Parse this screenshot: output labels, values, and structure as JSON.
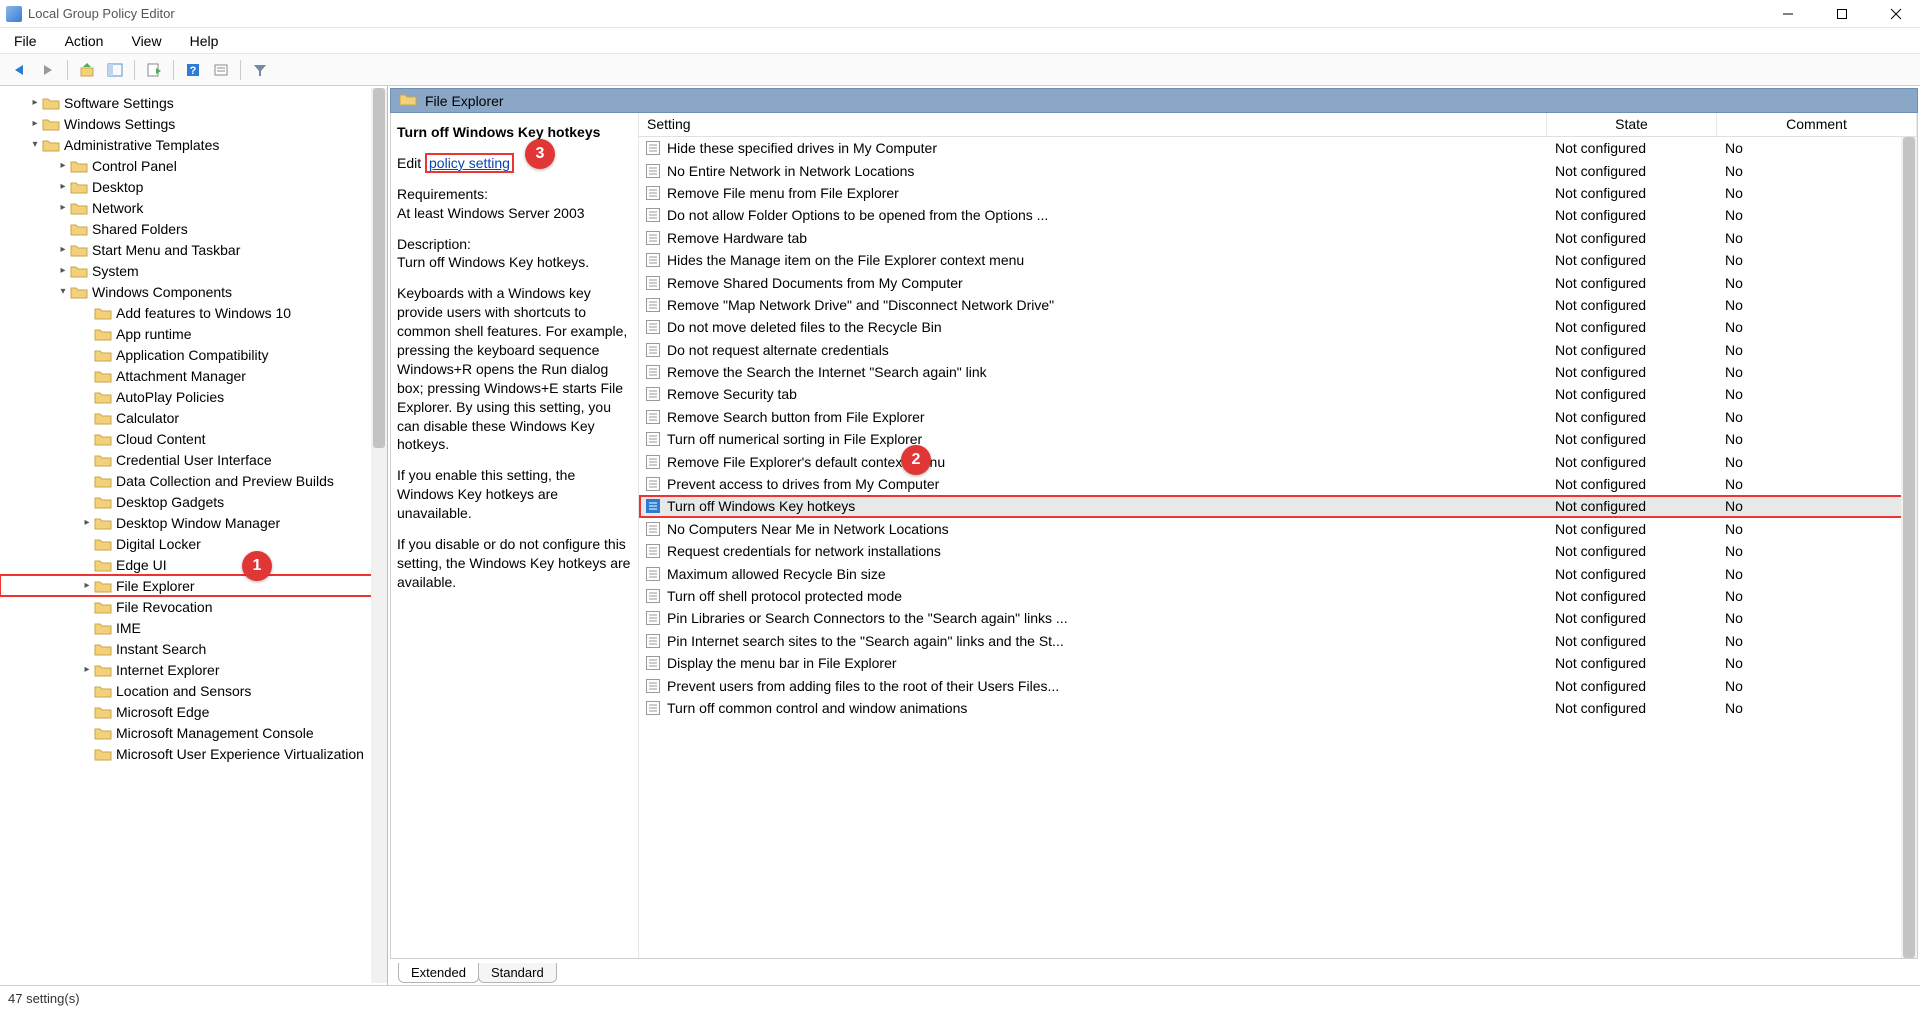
{
  "window": {
    "title": "Local Group Policy Editor"
  },
  "menubar": [
    "File",
    "Action",
    "View",
    "Help"
  ],
  "tree": {
    "root": [
      {
        "label": "Software Settings",
        "indent": 0,
        "chev": ">"
      },
      {
        "label": "Windows Settings",
        "indent": 0,
        "chev": ">"
      },
      {
        "label": "Administrative Templates",
        "indent": 0,
        "chev": "v"
      },
      {
        "label": "Control Panel",
        "indent": 1,
        "chev": ">"
      },
      {
        "label": "Desktop",
        "indent": 1,
        "chev": ">"
      },
      {
        "label": "Network",
        "indent": 1,
        "chev": ">"
      },
      {
        "label": "Shared Folders",
        "indent": 1,
        "chev": ""
      },
      {
        "label": "Start Menu and Taskbar",
        "indent": 1,
        "chev": ">"
      },
      {
        "label": "System",
        "indent": 1,
        "chev": ">"
      },
      {
        "label": "Windows Components",
        "indent": 1,
        "chev": "v"
      },
      {
        "label": "Add features to Windows 10",
        "indent": 2,
        "chev": ""
      },
      {
        "label": "App runtime",
        "indent": 2,
        "chev": ""
      },
      {
        "label": "Application Compatibility",
        "indent": 2,
        "chev": ""
      },
      {
        "label": "Attachment Manager",
        "indent": 2,
        "chev": ""
      },
      {
        "label": "AutoPlay Policies",
        "indent": 2,
        "chev": ""
      },
      {
        "label": "Calculator",
        "indent": 2,
        "chev": ""
      },
      {
        "label": "Cloud Content",
        "indent": 2,
        "chev": ""
      },
      {
        "label": "Credential User Interface",
        "indent": 2,
        "chev": ""
      },
      {
        "label": "Data Collection and Preview Builds",
        "indent": 2,
        "chev": ""
      },
      {
        "label": "Desktop Gadgets",
        "indent": 2,
        "chev": ""
      },
      {
        "label": "Desktop Window Manager",
        "indent": 2,
        "chev": ">"
      },
      {
        "label": "Digital Locker",
        "indent": 2,
        "chev": ""
      },
      {
        "label": "Edge UI",
        "indent": 2,
        "chev": ""
      },
      {
        "label": "File Explorer",
        "indent": 2,
        "chev": ">",
        "selected": true,
        "boxed": true
      },
      {
        "label": "File Revocation",
        "indent": 2,
        "chev": ""
      },
      {
        "label": "IME",
        "indent": 2,
        "chev": ""
      },
      {
        "label": "Instant Search",
        "indent": 2,
        "chev": ""
      },
      {
        "label": "Internet Explorer",
        "indent": 2,
        "chev": ">"
      },
      {
        "label": "Location and Sensors",
        "indent": 2,
        "chev": ""
      },
      {
        "label": "Microsoft Edge",
        "indent": 2,
        "chev": ""
      },
      {
        "label": "Microsoft Management Console",
        "indent": 2,
        "chev": ""
      },
      {
        "label": "Microsoft User Experience Virtualization",
        "indent": 2,
        "chev": ""
      }
    ]
  },
  "right": {
    "header": "File Explorer",
    "desc": {
      "title": "Turn off Windows Key hotkeys",
      "edit_prefix": "Edit ",
      "edit_link": "policy setting",
      "req_label": "Requirements:",
      "req_value": "At least Windows Server 2003",
      "desc_label": "Description:",
      "desc_short": "Turn off Windows Key hotkeys.",
      "para1": "Keyboards with a Windows key provide users with shortcuts to common shell features. For example, pressing the keyboard sequence Windows+R opens the Run dialog box; pressing Windows+E starts File Explorer. By using this setting, you can disable these Windows Key hotkeys.",
      "para2": "If you enable this setting, the Windows Key hotkeys are unavailable.",
      "para3": "If you disable or do not configure this setting, the Windows Key hotkeys are available."
    },
    "columns": {
      "setting": "Setting",
      "state": "State",
      "comment": "Comment"
    },
    "rows": [
      {
        "s": "Hide these specified drives in My Computer",
        "st": "Not configured",
        "c": "No"
      },
      {
        "s": "No Entire Network in Network Locations",
        "st": "Not configured",
        "c": "No"
      },
      {
        "s": "Remove File menu from File Explorer",
        "st": "Not configured",
        "c": "No"
      },
      {
        "s": "Do not allow Folder Options to be opened from the Options ...",
        "st": "Not configured",
        "c": "No"
      },
      {
        "s": "Remove Hardware tab",
        "st": "Not configured",
        "c": "No"
      },
      {
        "s": "Hides the Manage item on the File Explorer context menu",
        "st": "Not configured",
        "c": "No"
      },
      {
        "s": "Remove Shared Documents from My Computer",
        "st": "Not configured",
        "c": "No"
      },
      {
        "s": "Remove \"Map Network Drive\" and \"Disconnect Network Drive\"",
        "st": "Not configured",
        "c": "No"
      },
      {
        "s": "Do not move deleted files to the Recycle Bin",
        "st": "Not configured",
        "c": "No"
      },
      {
        "s": "Do not request alternate credentials",
        "st": "Not configured",
        "c": "No"
      },
      {
        "s": "Remove the Search the Internet \"Search again\" link",
        "st": "Not configured",
        "c": "No"
      },
      {
        "s": "Remove Security tab",
        "st": "Not configured",
        "c": "No"
      },
      {
        "s": "Remove Search button from File Explorer",
        "st": "Not configured",
        "c": "No"
      },
      {
        "s": "Turn off numerical sorting in File Explorer",
        "st": "Not configured",
        "c": "No"
      },
      {
        "s": "Remove File Explorer's default context menu",
        "st": "Not configured",
        "c": "No"
      },
      {
        "s": "Prevent access to drives from My Computer",
        "st": "Not configured",
        "c": "No"
      },
      {
        "s": "Turn off Windows Key hotkeys",
        "st": "Not configured",
        "c": "No",
        "selected": true,
        "boxed": true
      },
      {
        "s": "No Computers Near Me in Network Locations",
        "st": "Not configured",
        "c": "No"
      },
      {
        "s": "Request credentials for network installations",
        "st": "Not configured",
        "c": "No"
      },
      {
        "s": "Maximum allowed Recycle Bin size",
        "st": "Not configured",
        "c": "No"
      },
      {
        "s": "Turn off shell protocol protected mode",
        "st": "Not configured",
        "c": "No"
      },
      {
        "s": "Pin Libraries or Search Connectors to the \"Search again\" links ...",
        "st": "Not configured",
        "c": "No"
      },
      {
        "s": "Pin Internet search sites to the \"Search again\" links and the St...",
        "st": "Not configured",
        "c": "No"
      },
      {
        "s": "Display the menu bar in File Explorer",
        "st": "Not configured",
        "c": "No"
      },
      {
        "s": "Prevent users from adding files to the root of their Users Files...",
        "st": "Not configured",
        "c": "No"
      },
      {
        "s": "Turn off common control and window animations",
        "st": "Not configured",
        "c": "No"
      }
    ],
    "tabs": {
      "extended": "Extended",
      "standard": "Standard"
    }
  },
  "statusbar": "47 setting(s)",
  "annotations": {
    "a1": "1",
    "a2": "2",
    "a3": "3"
  }
}
